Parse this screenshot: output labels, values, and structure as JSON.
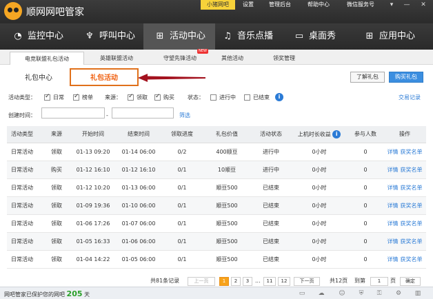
{
  "app": {
    "title": "顺网网吧管家"
  },
  "topmenu": [
    "小猪网吧",
    "设置",
    "管理后台",
    "帮助中心",
    "微信服务号"
  ],
  "window_controls": [
    "▾",
    "—",
    "✕"
  ],
  "nav": [
    {
      "label": "监控中心",
      "icon": "monitor-icon",
      "glyph": "◔"
    },
    {
      "label": "呼叫中心",
      "icon": "microphone-icon",
      "glyph": "♆"
    },
    {
      "label": "活动中心",
      "icon": "gift-icon",
      "glyph": "⊞"
    },
    {
      "label": "音乐点播",
      "icon": "music-icon",
      "glyph": "♫"
    },
    {
      "label": "桌面秀",
      "icon": "desktop-icon",
      "glyph": "▭"
    },
    {
      "label": "应用中心",
      "icon": "apps-icon",
      "glyph": "⊞"
    }
  ],
  "subtabs": [
    "电竞联盟礼包活动",
    "英雄联盟活动",
    "守望先锋活动",
    "其他活动",
    "领奖管理"
  ],
  "new_badge": "NEW",
  "sections": [
    "礼包中心",
    "礼包活动"
  ],
  "buttons": {
    "learn": "了解礼包",
    "buy": "购买礼包"
  },
  "filters": {
    "type_label": "活动类型：",
    "type_options": [
      "日常",
      "榜单"
    ],
    "source_label": "来源：",
    "source_options": [
      "领取",
      "购买"
    ],
    "status_label": "状态：",
    "status_options": [
      "进行中",
      "已结束"
    ],
    "info": "i",
    "created_label": "创建时间：",
    "dash": "-",
    "filter_link": "筛选",
    "records_link": "交易记录"
  },
  "table": {
    "headers": [
      "活动类型",
      "来源",
      "开始时间",
      "结束时间",
      "领取进度",
      "礼包价值",
      "活动状态",
      "上机时长收益",
      "参与人数",
      "操作"
    ],
    "rows": [
      [
        "日常活动",
        "领取",
        "01-13 09:20",
        "01-14 06:00",
        "0/2",
        "400顺豆",
        "进行中",
        "0小时",
        "0"
      ],
      [
        "日常活动",
        "购买",
        "01-12 16:10",
        "01-12 16:10",
        "0/1",
        "10顺豆",
        "进行中",
        "0小时",
        "0"
      ],
      [
        "日常活动",
        "领取",
        "01-12 10:20",
        "01-13 06:00",
        "0/1",
        "顺豆500",
        "已结束",
        "0小时",
        "0"
      ],
      [
        "日常活动",
        "领取",
        "01-09 19:36",
        "01-10 06:00",
        "0/1",
        "顺豆500",
        "已结束",
        "0小时",
        "0"
      ],
      [
        "日常活动",
        "领取",
        "01-06 17:26",
        "01-07 06:00",
        "0/1",
        "顺豆500",
        "已结束",
        "0小时",
        "0"
      ],
      [
        "日常活动",
        "领取",
        "01-05 16:33",
        "01-06 06:00",
        "0/1",
        "顺豆500",
        "已结束",
        "0小时",
        "0"
      ],
      [
        "日常活动",
        "领取",
        "01-04 14:22",
        "01-05 06:00",
        "0/1",
        "顺豆500",
        "已结束",
        "0小时",
        "0"
      ]
    ],
    "action_detail": "详情",
    "action_list": "获奖名单"
  },
  "pager": {
    "total": "共81条记录",
    "prev": "上一页",
    "pages": [
      "1",
      "2",
      "3"
    ],
    "ellipsis": "...",
    "last_pages": [
      "11",
      "12"
    ],
    "next": "下一页",
    "total_pages": "共12页",
    "goto": "到第",
    "page_input": "1",
    "page_unit": "页",
    "confirm": "确定"
  },
  "status": {
    "text": "网吧管家已保护您的网吧",
    "days": "205",
    "unit": "天"
  }
}
